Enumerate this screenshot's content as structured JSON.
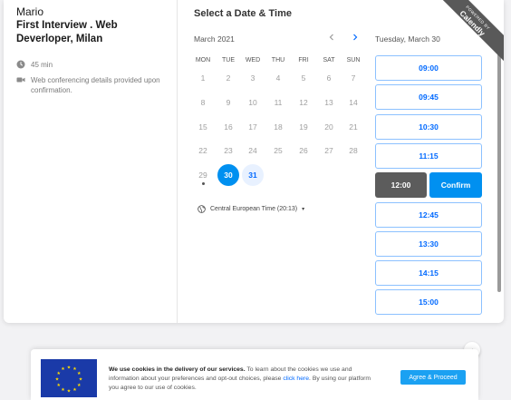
{
  "event": {
    "host": "Mario",
    "title": "First Interview . Web Deverloper, Milan",
    "duration": "45 min",
    "conferencing": "Web conferencing details provided upon confirmation.",
    "duration_icon": "clock-icon",
    "conferencing_icon": "video-conference-icon"
  },
  "calendar": {
    "title": "Select a Date & Time",
    "month": "March 2021",
    "prev_icon": "chevron-left-icon",
    "next_icon": "chevron-right-icon",
    "weekdays": [
      "MON",
      "TUE",
      "WED",
      "THU",
      "FRI",
      "SAT",
      "SUN"
    ],
    "weeks": [
      [
        "1",
        "2",
        "3",
        "4",
        "5",
        "6",
        "7"
      ],
      [
        "8",
        "9",
        "10",
        "11",
        "12",
        "13",
        "14"
      ],
      [
        "15",
        "16",
        "17",
        "18",
        "19",
        "20",
        "21"
      ],
      [
        "22",
        "23",
        "24",
        "25",
        "26",
        "27",
        "28"
      ],
      [
        "29",
        "30",
        "31"
      ]
    ],
    "today": "29",
    "selected_day": "30",
    "available_days": [
      "30",
      "31"
    ],
    "timezone": "Central European Time (20:13)",
    "timezone_icon": "globe-icon",
    "selected_color": "#0090f0",
    "available_color": "#0069ff"
  },
  "times": {
    "selected_date": "Tuesday, March 30",
    "slots_before": [
      "09:00",
      "09:45",
      "10:30",
      "11:15"
    ],
    "selected_slot": "12:00",
    "confirm_label": "Confirm",
    "slots_after": [
      "12:45",
      "13:30",
      "14:15",
      "15:00"
    ]
  },
  "ribbon": {
    "small_text": "POWERED BY",
    "brand": "Calendly"
  },
  "cookie": {
    "bold": "We use cookies in the delivery of our services.",
    "text1": " To learn about the cookies we use and information about your preferences and opt-out choices, please ",
    "link": "click here",
    "text2": ". By using our platform you agree to our use of cookies.",
    "accept_label": "Agree & Proceed",
    "flag_icon": "eu-flag-icon",
    "collapse_icon": "chevron-up-icon",
    "flag_color": "#1a3aa8"
  }
}
